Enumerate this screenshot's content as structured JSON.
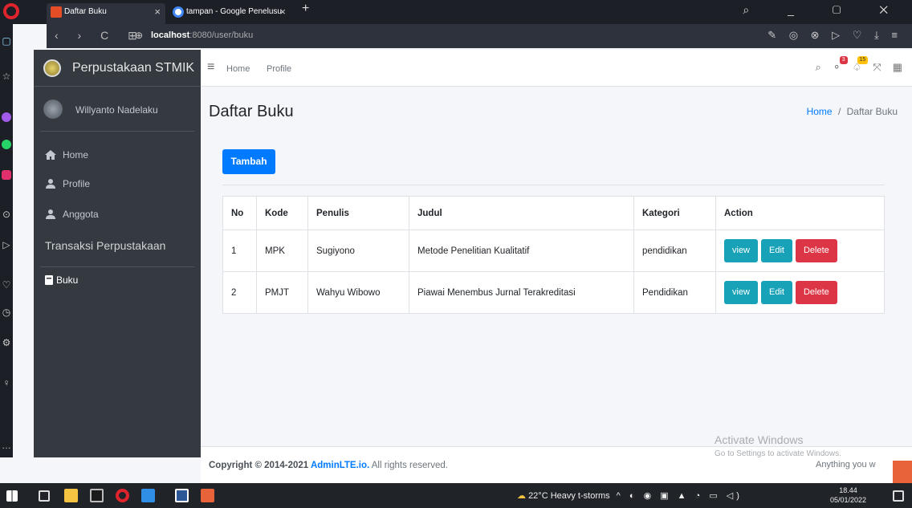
{
  "browser": {
    "tabs": [
      {
        "label": "Daftar Buku",
        "active": true
      },
      {
        "label": "tampan - Google Penelusu",
        "active": false
      }
    ],
    "new_tab": "+",
    "url_host": "localhost",
    "url_rest": ":8080/user/buku",
    "nav": "‹ › C ⊞"
  },
  "sidebar": {
    "brand": "Perpustakaan STMIK",
    "user": "Willyanto Nadelaku",
    "items": [
      {
        "label": "Home",
        "icon": "home-icon"
      },
      {
        "label": "Profile",
        "icon": "user-icon"
      },
      {
        "label": "Anggota",
        "icon": "user-icon"
      }
    ],
    "section": "Transaksi Perpustakaan",
    "section_items": [
      {
        "label": "Buku",
        "icon": "book-icon"
      }
    ]
  },
  "topnav": {
    "links": [
      "Home",
      "Profile"
    ],
    "badges": {
      "messages": "3",
      "notifications": "15"
    }
  },
  "page": {
    "title": "Daftar Buku",
    "breadcrumb": {
      "home": "Home",
      "sep": "/",
      "current": "Daftar Buku"
    },
    "add_button": "Tambah"
  },
  "table": {
    "headers": [
      "No",
      "Kode",
      "Penulis",
      "Judul",
      "Kategori",
      "Action"
    ],
    "rows": [
      [
        "1",
        "MPK",
        "Sugiyono",
        "Metode Penelitian Kualitatif",
        "pendidikan"
      ],
      [
        "2",
        "PMJT",
        "Wahyu Wibowo",
        "Piawai Menembus Jurnal Terakreditasi",
        "Pendidikan"
      ]
    ],
    "actions": {
      "view": "view",
      "edit": "Edit",
      "delete": "Delete"
    }
  },
  "footer": {
    "prefix": "Copyright © 2014-2021 ",
    "brand": "AdminLTE.io.",
    "suffix": " All rights reserved."
  },
  "overlay": {
    "activate_title": "Activate Windows",
    "activate_sub": "Go to Settings to activate Windows.",
    "anything": "Anything you w"
  },
  "taskbar": {
    "weather": "22°C  Heavy t-storms",
    "time": "18.44",
    "date": "05/01/2022"
  },
  "colors": {
    "primary": "#007bff",
    "info": "#17a2b8",
    "danger": "#dc3545",
    "sidebar": "#343a40"
  }
}
